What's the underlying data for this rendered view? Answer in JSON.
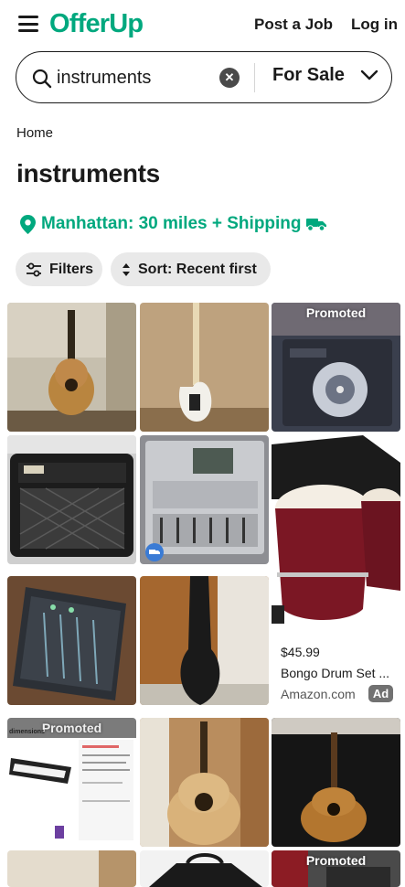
{
  "header": {
    "brand": "OfferUp",
    "post_job": "Post a Job",
    "login": "Log in"
  },
  "search": {
    "query": "instruments",
    "category": "For Sale"
  },
  "breadcrumb": "Home",
  "page_title": "instruments",
  "location": "Manhattan: 30 miles + Shipping",
  "filters": {
    "filters_label": "Filters",
    "sort_label": "Sort: Recent first"
  },
  "listings": [
    {
      "subject": "acoustic guitar"
    },
    {
      "subject": "white bass guitar"
    },
    {
      "subject": "dj turntable",
      "badge": "Promoted"
    },
    {
      "subject": "vox amplifier"
    },
    {
      "subject": "digital mixer",
      "shipping": true
    },
    {
      "subject": "bongo drum set"
    },
    {
      "subject": "audio mixer"
    },
    {
      "subject": "guitar case"
    },
    {
      "subject": "digital piano",
      "badge": "Promoted",
      "inset_text": "dimensions"
    },
    {
      "subject": "acoustic guitar on stand"
    },
    {
      "subject": "classical guitar in case"
    },
    {
      "subject": "partial item"
    },
    {
      "subject": "black bag"
    },
    {
      "subject": "promoted item",
      "badge": "Promoted"
    }
  ],
  "ad": {
    "price": "$45.99",
    "title": "Bongo Drum Set ...",
    "source": "Amazon.com",
    "badge": "Ad"
  },
  "colors": {
    "brand": "#00a87e",
    "chip_bg": "#e9e9e9",
    "text": "#1a1a1a"
  }
}
